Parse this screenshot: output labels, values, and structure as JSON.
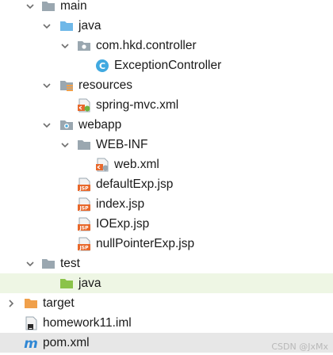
{
  "tree": {
    "main_label": "main",
    "java_label": "java",
    "package_label": "com.hkd.controller",
    "class_label": "ExceptionController",
    "class_icon_letter": "C",
    "resources_label": "resources",
    "spring_mvc_label": "spring-mvc.xml",
    "webapp_label": "webapp",
    "webinf_label": "WEB-INF",
    "webxml_label": "web.xml",
    "defaultexp_label": "defaultExp.jsp",
    "index_label": "index.jsp",
    "ioexp_label": "IOExp.jsp",
    "nullpointer_label": "nullPointerExp.jsp",
    "test_label": "test",
    "test_java_label": "java",
    "target_label": "target",
    "iml_label": "homework11.iml",
    "pom_label": "pom.xml",
    "pom_icon_letter": "m",
    "jsp_icon_text": "JSP"
  },
  "watermark": "CSDN @JxMx",
  "colors": {
    "folder_gray": "#9aa7b0",
    "folder_blue": "#6fb8e8",
    "folder_green": "#8bc34a",
    "folder_orange": "#f0a04b",
    "jsp_orange": "#e8682b",
    "class_blue": "#40a9e0",
    "maven_blue": "#2f87d4",
    "highlight_green": "#eef6e4",
    "selected_gray": "#e7e7e7"
  },
  "icons": {
    "main": "folder-icon",
    "java": "source-folder-icon",
    "package": "package-icon",
    "class": "class-icon",
    "resources": "resources-folder-icon",
    "spring_mvc": "xml-config-file-icon",
    "webapp": "web-folder-icon",
    "webinf": "folder-icon",
    "webxml": "xml-config-file-icon",
    "jsp": "jsp-file-icon",
    "test": "folder-icon",
    "test_java": "test-source-folder-icon",
    "target": "excluded-folder-icon",
    "iml": "module-file-icon",
    "pom": "maven-icon"
  }
}
